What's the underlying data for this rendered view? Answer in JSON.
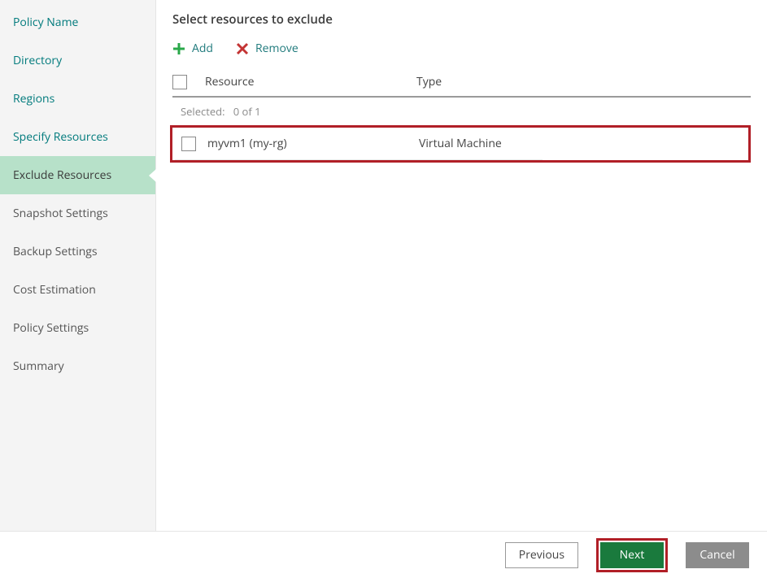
{
  "sidebar": {
    "items": [
      {
        "label": "Policy Name"
      },
      {
        "label": "Directory"
      },
      {
        "label": "Regions"
      },
      {
        "label": "Specify Resources"
      },
      {
        "label": "Exclude Resources"
      },
      {
        "label": "Snapshot Settings"
      },
      {
        "label": "Backup Settings"
      },
      {
        "label": "Cost Estimation"
      },
      {
        "label": "Policy Settings"
      },
      {
        "label": "Summary"
      }
    ],
    "active_index": 4
  },
  "page": {
    "title": "Select resources to exclude"
  },
  "toolbar": {
    "add_label": "Add",
    "remove_label": "Remove"
  },
  "table": {
    "headers": {
      "resource": "Resource",
      "type": "Type"
    },
    "selected_label": "Selected:",
    "selected_count": "0 of 1",
    "rows": [
      {
        "resource": "myvm1 (my-rg)",
        "type": "Virtual Machine"
      }
    ]
  },
  "footer": {
    "previous": "Previous",
    "next": "Next",
    "cancel": "Cancel"
  }
}
